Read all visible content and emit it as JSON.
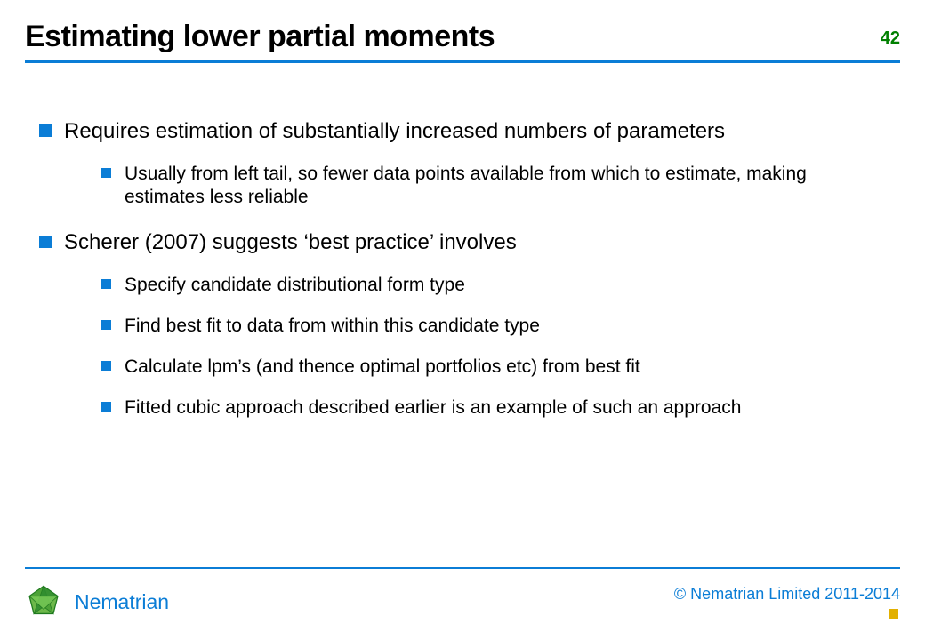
{
  "slide": {
    "title": "Estimating lower partial moments",
    "page_number": "42"
  },
  "bullets": [
    {
      "text": "Requires estimation of substantially increased numbers of parameters",
      "sub": [
        "Usually from left tail, so fewer data points available from which to estimate, making estimates less reliable"
      ]
    },
    {
      "text": "Scherer (2007) suggests ‘best practice’ involves",
      "sub": [
        "Specify candidate distributional form type",
        "Find best fit to data from within this candidate type",
        "Calculate lpm’s (and thence optimal portfolios etc) from best fit",
        "Fitted cubic approach described earlier is an example of such an approach"
      ]
    }
  ],
  "footer": {
    "brand": "Nematrian",
    "copyright": "© Nematrian Limited 2011-2014"
  }
}
